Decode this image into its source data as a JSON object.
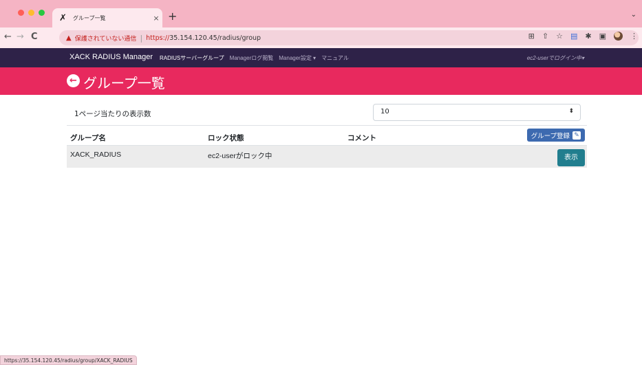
{
  "browser": {
    "tab_favicon": "✗",
    "tab_title": "グループ一覧",
    "tab_close": "×",
    "new_tab": "+",
    "tab_menu": "⌄",
    "nav_back": "←",
    "nav_forward": "→",
    "nav_reload": "C",
    "security_text": "保護されていない通信",
    "url_scheme": "https://",
    "url_rest": "35.154.120.45/radius/group",
    "status_url": "https://35.154.120.45/radius/group/XACK_RADIUS"
  },
  "app_nav": {
    "brand": "XACK RADIUS Manager",
    "links": [
      {
        "label": "RADIUSサーバーグループ",
        "active": true
      },
      {
        "label": "Managerログ閲覧",
        "active": false
      },
      {
        "label": "Manager設定 ▾",
        "active": false
      },
      {
        "label": "マニュアル",
        "active": false
      }
    ],
    "user_menu": "ec2-userでログイン中▾"
  },
  "header": {
    "title": "グループ一覧"
  },
  "controls": {
    "per_page_label": "1ページ当たりの表示数",
    "per_page_value": "10"
  },
  "table": {
    "columns": [
      "グループ名",
      "ロック状態",
      "コメント"
    ],
    "register_label": "グループ登録",
    "rows": [
      {
        "name": "XACK_RADIUS",
        "lock": "ec2-userがロック中",
        "comment": "",
        "action": "表示"
      }
    ]
  },
  "colors": {
    "tabbar": "#f5b4c4",
    "app_nav": "#2e2248",
    "header_band": "#e8295e",
    "register_button": "#3d6ab0",
    "show_button": "#217e8e"
  }
}
